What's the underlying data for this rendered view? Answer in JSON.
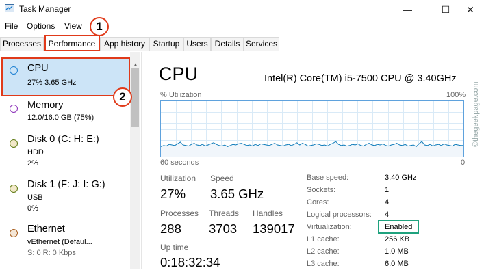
{
  "window": {
    "title": "Task Manager",
    "minimize": "—",
    "maximize": "☐",
    "close": "✕"
  },
  "menu": [
    "File",
    "Options",
    "View"
  ],
  "tabs": [
    "Processes",
    "Performance",
    "App history",
    "Startup",
    "Users",
    "Details",
    "Services"
  ],
  "sidebar": [
    {
      "title": "CPU",
      "sub": "27%  3.65 GHz",
      "sub2": "",
      "sub3": "",
      "circle": "#1b7fd2"
    },
    {
      "title": "Memory",
      "sub": "12.0/16.0 GB (75%)",
      "sub2": "",
      "sub3": "",
      "circle": "#8b2fb8"
    },
    {
      "title": "Disk 0 (C: H: E:)",
      "sub": "HDD",
      "sub2": "2%",
      "sub3": "",
      "circle": "#5f7a13"
    },
    {
      "title": "Disk 1 (F: J: I: G:)",
      "sub": "USB",
      "sub2": "0%",
      "sub3": "",
      "circle": "#5f7a13"
    },
    {
      "title": "Ethernet",
      "sub": "vEthernet (Defaul...",
      "sub2": "S: 0  R: 0 Kbps",
      "sub3": "",
      "circle": "#a75d1d"
    }
  ],
  "cpu": {
    "title": "CPU",
    "model": "Intel(R) Core(TM) i5-7500 CPU @ 3.40GHz",
    "util_label": "% Utilization",
    "util_max": "100%",
    "time_label": "60 seconds",
    "time_min": "0"
  },
  "stats": {
    "utilization_label": "Utilization",
    "utilization": "27%",
    "speed_label": "Speed",
    "speed": "3.65 GHz",
    "processes_label": "Processes",
    "processes": "288",
    "threads_label": "Threads",
    "threads": "3703",
    "handles_label": "Handles",
    "handles": "139017",
    "uptime_label": "Up time",
    "uptime": "0:18:32:34"
  },
  "info": [
    {
      "label": "Base speed:",
      "value": "3.40 GHz"
    },
    {
      "label": "Sockets:",
      "value": "1"
    },
    {
      "label": "Cores:",
      "value": "4"
    },
    {
      "label": "Logical processors:",
      "value": "4"
    },
    {
      "label": "Virtualization:",
      "value": "Enabled"
    },
    {
      "label": "L1 cache:",
      "value": "256 KB"
    },
    {
      "label": "L2 cache:",
      "value": "1.0 MB"
    },
    {
      "label": "L3 cache:",
      "value": "6.0 MB"
    }
  ],
  "annotations": {
    "one": "1",
    "two": "2"
  },
  "watermark": "©thegeekpage.com",
  "graph_samples": [
    18,
    20,
    19,
    22,
    21,
    20,
    23,
    26,
    21,
    20,
    19,
    22,
    24,
    21,
    20,
    22,
    19,
    21,
    23,
    25,
    22,
    20,
    19,
    21,
    18,
    20,
    22,
    21,
    23,
    24,
    22,
    20,
    21,
    19,
    22,
    20,
    23,
    22,
    21,
    20,
    22,
    24,
    21,
    20,
    19,
    21,
    22,
    20,
    22,
    25,
    21,
    24,
    22,
    19,
    20,
    21,
    23,
    22,
    20,
    21,
    19,
    22,
    24,
    27,
    22,
    20,
    21,
    19,
    20,
    22,
    21,
    23,
    20,
    19,
    22,
    24,
    21,
    20,
    22,
    21,
    23,
    20,
    19,
    21,
    22,
    24,
    21,
    20,
    22,
    19,
    20,
    21,
    18,
    23,
    27,
    21,
    20,
    22,
    19,
    21,
    22,
    20,
    23,
    21,
    20,
    19,
    22,
    21,
    20,
    20
  ]
}
